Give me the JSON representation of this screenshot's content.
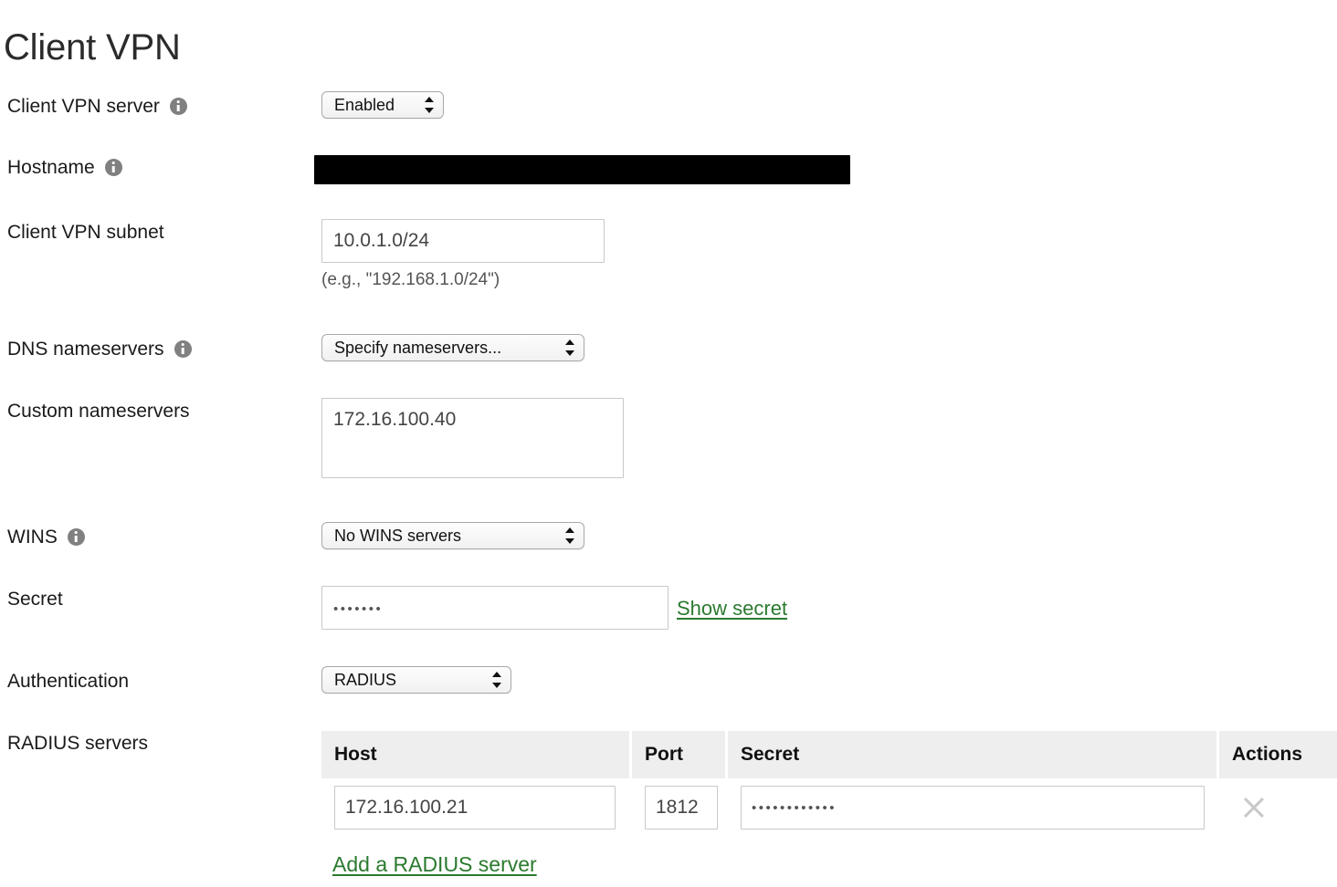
{
  "page": {
    "title": "Client VPN"
  },
  "fields": {
    "client_vpn_server": {
      "label": "Client VPN server",
      "info_icon": "info-icon",
      "value": "Enabled"
    },
    "hostname": {
      "label": "Hostname",
      "info_icon": "info-icon",
      "value": "",
      "redacted": true
    },
    "client_vpn_subnet": {
      "label": "Client VPN subnet",
      "value": "10.0.1.0/24",
      "hint": "(e.g., \"192.168.1.0/24\")"
    },
    "dns_nameservers": {
      "label": "DNS nameservers",
      "info_icon": "info-icon",
      "value": "Specify nameservers..."
    },
    "custom_nameservers": {
      "label": "Custom nameservers",
      "value": "172.16.100.40"
    },
    "wins": {
      "label": "WINS",
      "info_icon": "info-icon",
      "value": "No WINS servers"
    },
    "secret": {
      "label": "Secret",
      "value": "•••••••",
      "show_link": "Show secret"
    },
    "authentication": {
      "label": "Authentication",
      "value": "RADIUS"
    },
    "radius_servers": {
      "label": "RADIUS servers",
      "columns": [
        "Host",
        "Port",
        "Secret",
        "Actions"
      ],
      "rows": [
        {
          "host": "172.16.100.21",
          "port": "1812",
          "secret": "••••••••••••",
          "action_icon": "close-icon"
        }
      ],
      "add_link": "Add a RADIUS server"
    }
  },
  "colors": {
    "link_green": "#2b7a2f",
    "info_gray": "#808080",
    "table_header_bg": "#eeeeee",
    "input_border": "#c9c9c9",
    "redaction": "#000000"
  }
}
